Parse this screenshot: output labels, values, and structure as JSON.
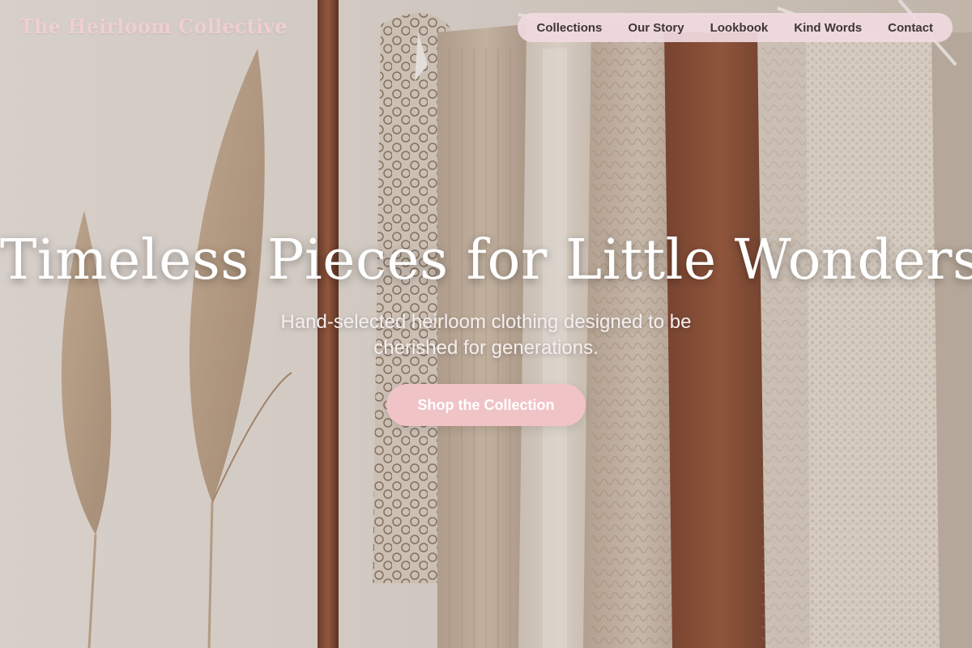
{
  "brand": {
    "name": "The Heirloom Collective"
  },
  "nav": {
    "items": [
      {
        "label": "Collections"
      },
      {
        "label": "Our Story"
      },
      {
        "label": "Lookbook"
      },
      {
        "label": "Kind Words"
      },
      {
        "label": "Contact"
      }
    ]
  },
  "hero": {
    "title": "Timeless Pieces for Little Wonders",
    "subtitle": "Hand-selected heirloom clothing designed to be cherished for generations.",
    "cta_label": "Shop the Collection",
    "background_subject": "clothing rack with knit sweaters and dried pampas grass"
  },
  "colors": {
    "brand_text": "#efcfd0",
    "nav_pill": "#f0dae0",
    "cta": "#f0c3c6",
    "title_text": "#ffffff"
  }
}
